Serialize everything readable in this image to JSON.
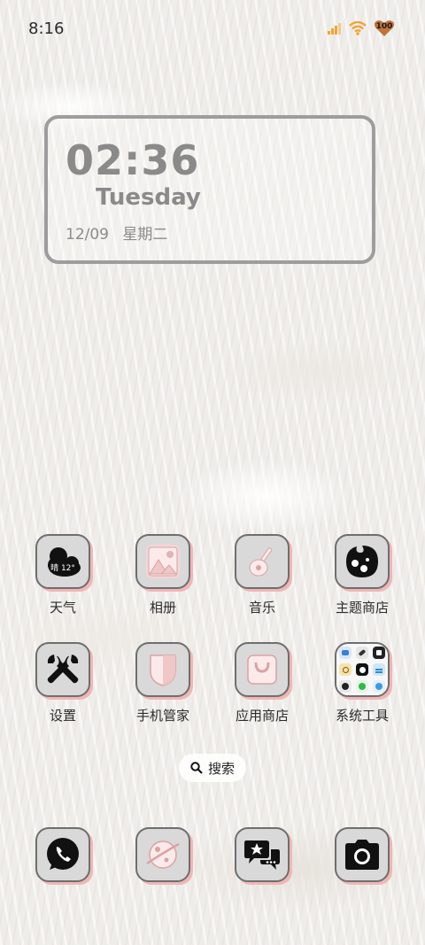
{
  "status_bar": {
    "time": "8:16",
    "battery": "100"
  },
  "clock_widget": {
    "time": "02:36",
    "day": "Tuesday",
    "date": "12/09",
    "weekday": "星期二"
  },
  "apps_row1": [
    {
      "label": "天气",
      "icon": "weather-icon",
      "badge": "晴 12°"
    },
    {
      "label": "相册",
      "icon": "gallery-icon"
    },
    {
      "label": "音乐",
      "icon": "music-icon"
    },
    {
      "label": "主题商店",
      "icon": "theme-store-icon"
    }
  ],
  "apps_row2": [
    {
      "label": "设置",
      "icon": "settings-icon"
    },
    {
      "label": "手机管家",
      "icon": "phone-manager-icon"
    },
    {
      "label": "应用商店",
      "icon": "app-store-icon"
    },
    {
      "label": "系统工具",
      "icon": "folder-icon"
    }
  ],
  "search": {
    "label": "搜索"
  },
  "dock": [
    {
      "icon": "phone-icon"
    },
    {
      "icon": "browser-icon"
    },
    {
      "icon": "messages-icon"
    },
    {
      "icon": "camera-icon"
    }
  ],
  "colors": {
    "tile": "#d9d9d9",
    "tile_shadow": "#f0b6b6",
    "status_orange": "#f2a43a"
  }
}
